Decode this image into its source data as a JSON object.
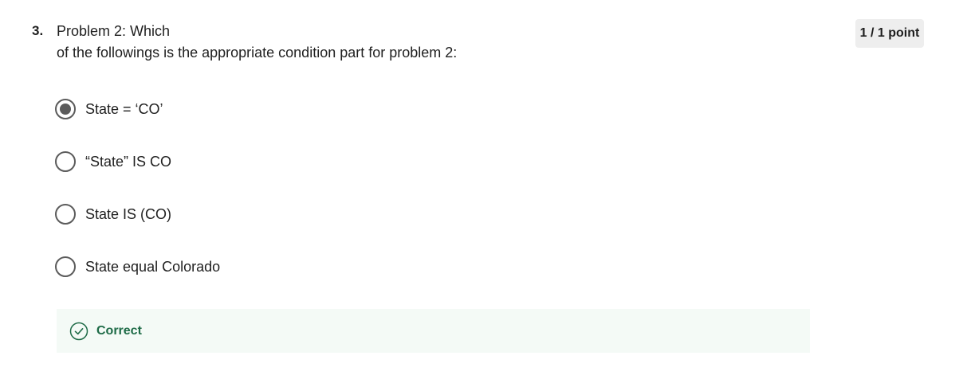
{
  "question": {
    "number": "3.",
    "line1": "Problem 2: Which",
    "line2": "of the followings is the appropriate condition part for problem 2:"
  },
  "score": "1 / 1 point",
  "options": [
    {
      "label": "State = ‘CO’",
      "selected": true
    },
    {
      "label": "“State” IS CO",
      "selected": false
    },
    {
      "label": "State IS (CO)",
      "selected": false
    },
    {
      "label": "State equal Colorado",
      "selected": false
    }
  ],
  "feedback": {
    "text": "Correct",
    "icon": "check-circle-icon",
    "color": "#1e6b47"
  },
  "colors": {
    "radio": "#5b5b5b",
    "feedback_bg": "#f4faf6",
    "badge_bg": "#eeeeee"
  }
}
